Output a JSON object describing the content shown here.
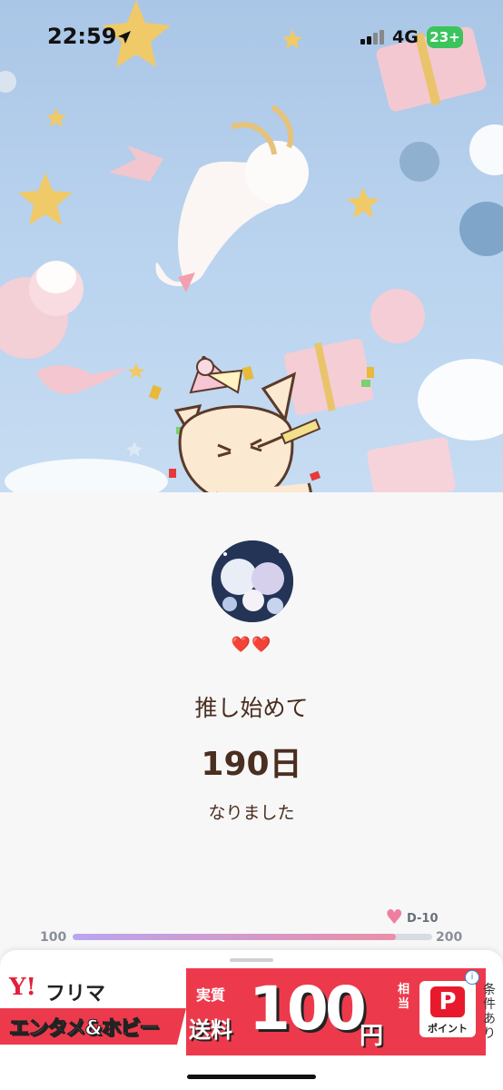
{
  "status_bar": {
    "time": "22:59",
    "network": "4G",
    "battery": "23+",
    "location_icon": "location-arrow-icon",
    "signal_icon": "signal-bars-icon"
  },
  "counter": {
    "hearts": "❤️❤️",
    "label_top": "推し始めて",
    "days": "190日",
    "label_bottom": "なりました"
  },
  "progress": {
    "min_label": "100",
    "max_label": "200",
    "countdown_label": "D-10",
    "value": 190,
    "min": 100,
    "max": 200,
    "marker_icon": "heart-icon",
    "colors": {
      "start": "#b9a6f0",
      "end": "#ea8fa8",
      "track": "#d9dbe3"
    }
  },
  "ad": {
    "brand_logo": "Y!",
    "brand_name": "フリマ",
    "category": "エンタメ&ホビー",
    "tag": "実質",
    "shipping_label": "送料",
    "price": "100",
    "currency": "円",
    "note": "相当",
    "point_logo": "P",
    "point_label": "ポイント",
    "info_icon": "i",
    "conditions": "条件あり",
    "colors": {
      "primary": "#ec3a4c",
      "logo": "#e2203a"
    }
  }
}
